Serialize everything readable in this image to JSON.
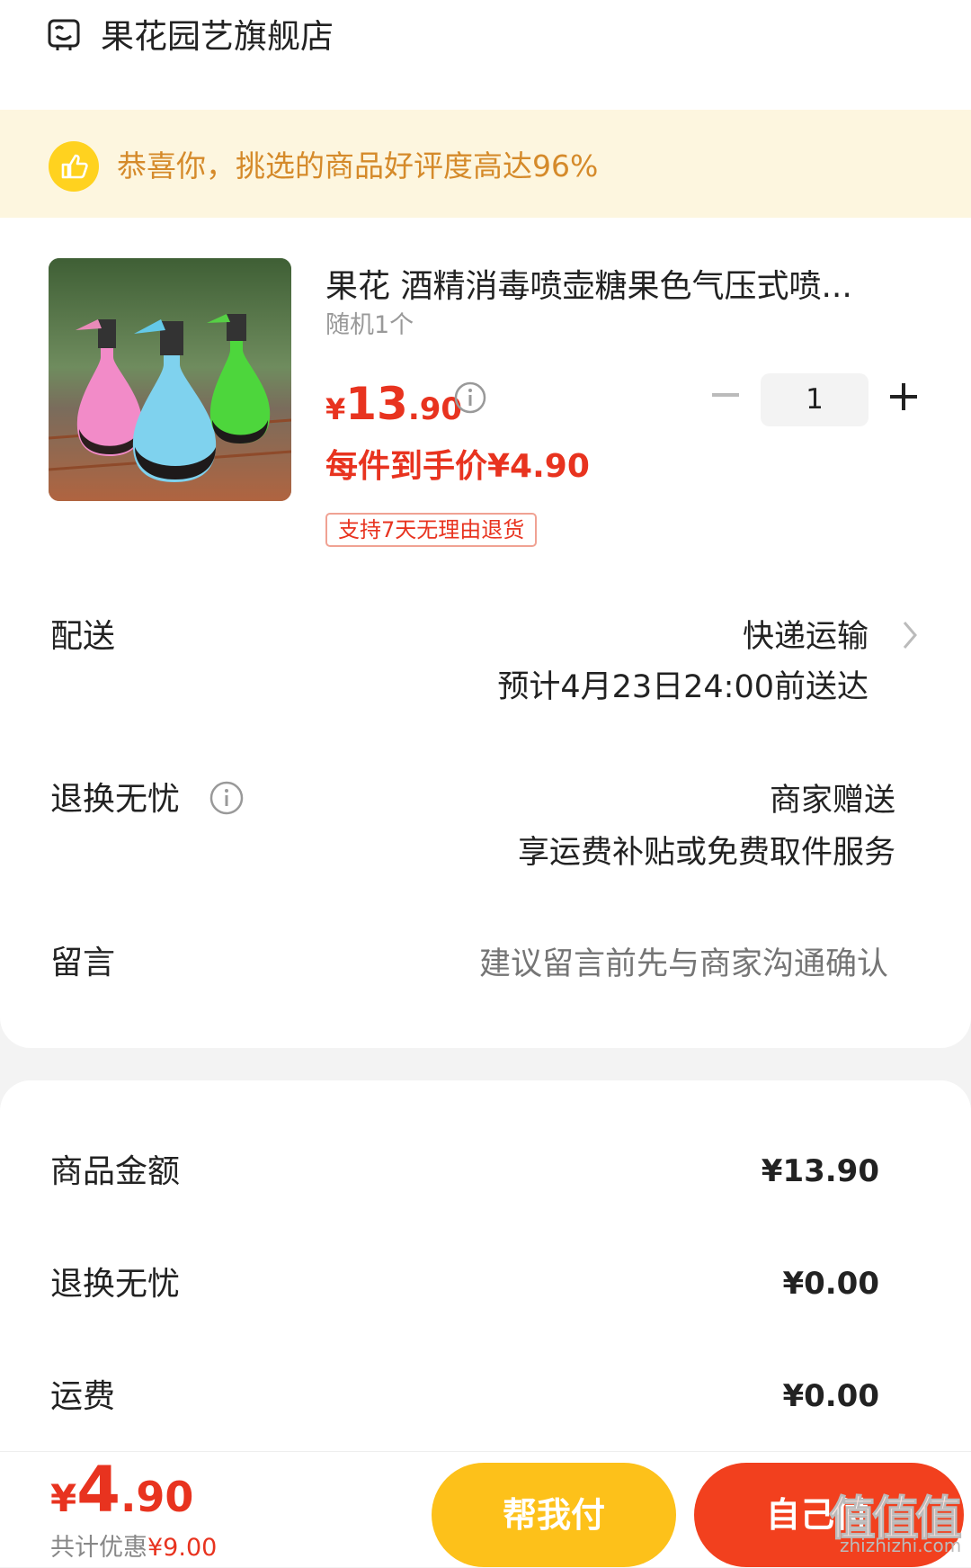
{
  "store": {
    "name": "果花园艺旗舰店"
  },
  "banner": {
    "text": "恭喜你，挑选的商品好评度高达96%"
  },
  "product": {
    "title": "果花 酒精消毒喷壶糖果色气压式喷...",
    "variant": "随机1个",
    "price_currency": "¥",
    "price_int": "13",
    "price_dec": ".90",
    "quantity": "1",
    "final_price": "每件到手价¥4.90",
    "return_badge": "支持7天无理由退货"
  },
  "delivery": {
    "label": "配送",
    "method": "快递运输",
    "estimate": "预计4月23日24:00前送达"
  },
  "return_service": {
    "label": "退换无忧",
    "value": "商家赠送",
    "detail": "享运费补贴或免费取件服务"
  },
  "message": {
    "label": "留言",
    "placeholder": "建议留言前先与商家沟通确认"
  },
  "summary": {
    "items": [
      {
        "label": "商品金额",
        "value": "¥13.90"
      },
      {
        "label": "退换无忧",
        "value": "¥0.00"
      },
      {
        "label": "运费",
        "value": "¥0.00"
      }
    ]
  },
  "bottom": {
    "total_currency": "¥",
    "total_int": "4",
    "total_dec": ".90",
    "saving_prefix": "共计优惠",
    "saving_value": "¥9.00",
    "help_pay_label": "帮我付",
    "self_pay_label": "自己付"
  },
  "watermark": {
    "text": "值值值",
    "url": "zhizhizhi.com"
  },
  "colors": {
    "accent_red": "#e8331f",
    "banner_bg": "#fdf6df",
    "banner_text": "#d58a2a",
    "help_btn": "#fdc11a",
    "self_btn": "#f2401e"
  }
}
